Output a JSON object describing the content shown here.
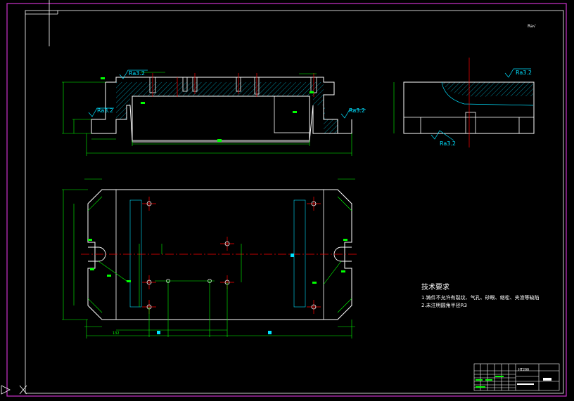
{
  "colors": {
    "background": "#000000",
    "outer_border": "#cc33cc",
    "outline": "#ffffff",
    "dimension": "#00ff00",
    "centerline": "#ff0000",
    "hidden": "#00e0ff",
    "hatch": "#00e0ff"
  },
  "annotations": {
    "roughness_corner": "Ra√",
    "ra_front_top": "Ra3.2",
    "ra_front_left": "Ra3.2",
    "ra_front_right": "Ra3.2",
    "ra_side_top": "Ra3.2",
    "ra_side_bottom": "Ra3.2"
  },
  "dimensions": {
    "bottom_left_offset": "132"
  },
  "tech_requirements": {
    "title": "技术要求",
    "line1": "1.铸件不允许有裂纹、气孔、砂眼、缩松、夹渣等缺陷",
    "line2": "2.未注明圆角半径R3"
  },
  "title_block": {
    "material": "HT200"
  }
}
